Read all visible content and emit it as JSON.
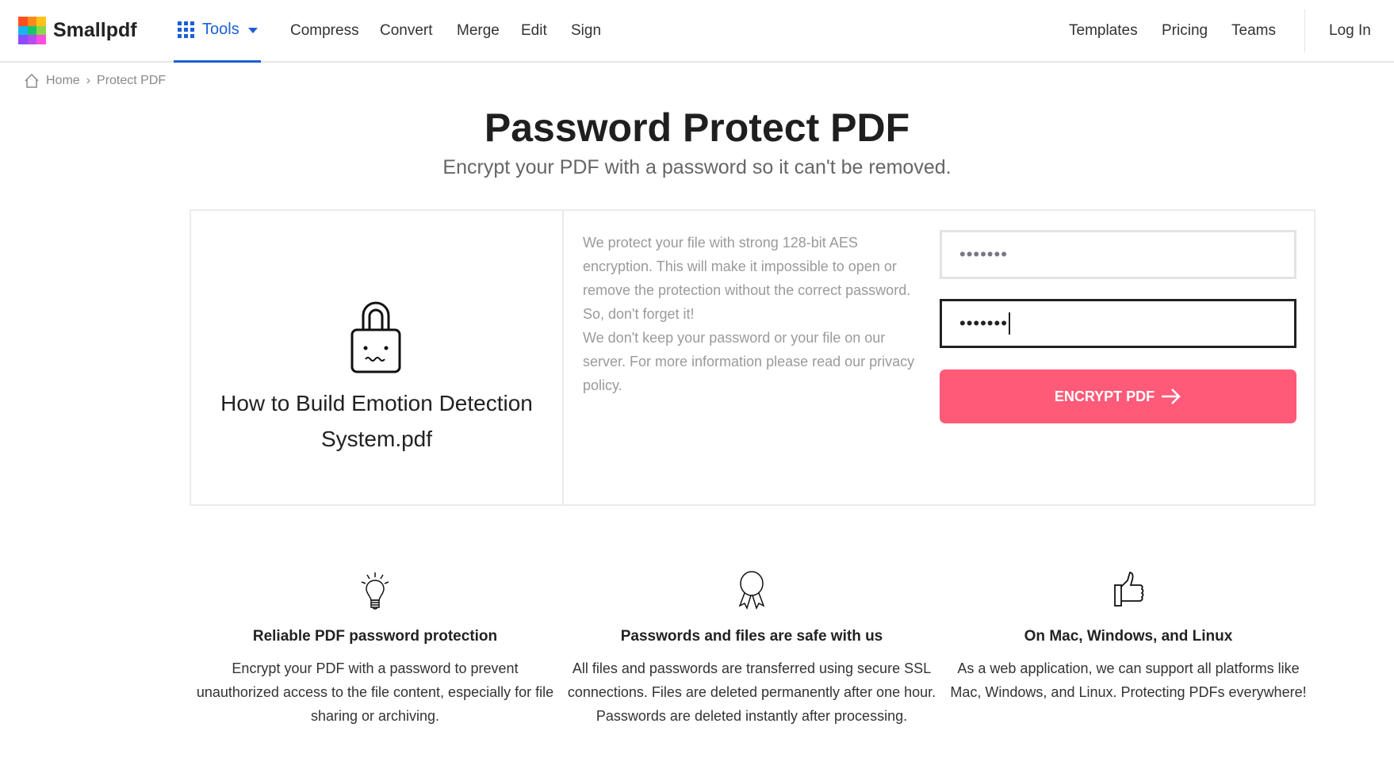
{
  "nav": {
    "brand": "Smallpdf",
    "tools_label": "Tools",
    "links": [
      "Compress",
      "Convert",
      "Merge",
      "Edit",
      "Sign"
    ],
    "right_links": [
      "Templates",
      "Pricing",
      "Teams"
    ],
    "login": "Log In",
    "accent": "#1b5fd6"
  },
  "breadcrumb": {
    "home": "Home",
    "separator": "›",
    "current": "Protect PDF"
  },
  "header": {
    "title": "Password Protect PDF",
    "subtitle": "Encrypt your PDF with a password so it can't be removed."
  },
  "panel": {
    "file_icon": "sad-lock-icon",
    "filename_line1": "How to Build Emotion Detection",
    "filename_line2": "System.pdf",
    "info_1": "We protect your file with strong 128-bit AES encryption. This will make it impossible to open or remove the protection without the correct password. So, don't forget it!",
    "info_2": "We don't keep your password or your file on our server. For more information please read our privacy policy.",
    "password_value": "•••••••",
    "confirm_value": "•••••••",
    "button_label": "ENCRYPT PDF",
    "button_color": "#ff5a78"
  },
  "features": [
    {
      "icon": "lightbulb-icon",
      "title": "Reliable PDF password protection",
      "text": "Encrypt your PDF with a password to prevent unauthorized access to the file content, especially for file sharing or archiving."
    },
    {
      "icon": "award-ribbon-icon",
      "title": "Passwords and files are safe with us",
      "text": "All files and passwords are transferred using secure SSL connections. Files are deleted permanently after one hour. Passwords are deleted instantly after processing."
    },
    {
      "icon": "thumbs-up-icon",
      "title": "On Mac, Windows, and Linux",
      "text": "As a web application, we can support all platforms like Mac, Windows, and Linux. Protecting PDFs everywhere!"
    }
  ]
}
